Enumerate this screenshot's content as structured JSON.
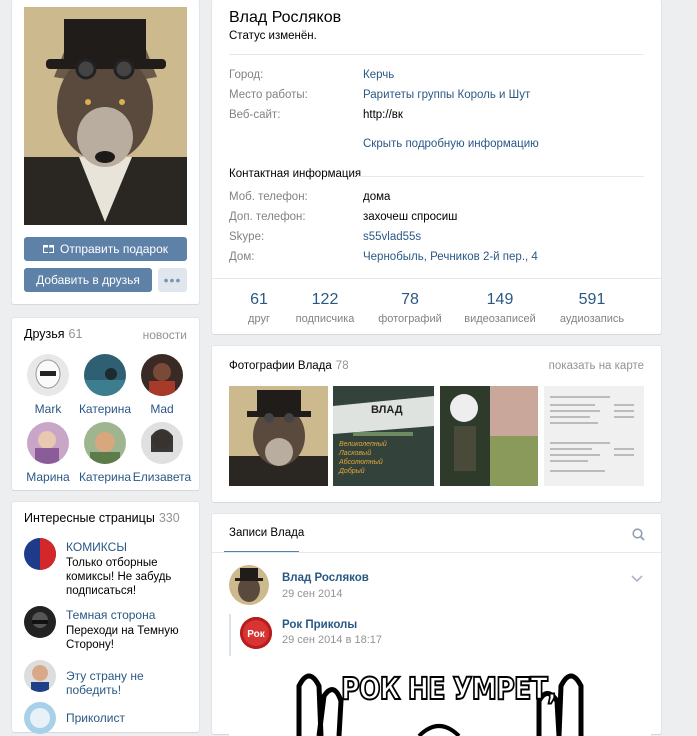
{
  "profile": {
    "name": "Влад Росляков",
    "status": "Статус изменён.",
    "info": [
      {
        "key": "Город:",
        "value": "Керчь",
        "link": true
      },
      {
        "key": "Место работы:",
        "value": "Раритеты группы Король и Шут",
        "link": true
      },
      {
        "key": "Веб-сайт:",
        "value": "http://вк",
        "link": false
      }
    ],
    "more_info": "Скрыть подробную информацию",
    "contact_heading": "Контактная информация",
    "contacts": [
      {
        "key": "Моб. телефон:",
        "value": "дома",
        "link": false
      },
      {
        "key": "Доп. телефон:",
        "value": "захочеш спросиш",
        "link": false
      },
      {
        "key": "Skype:",
        "value": "s55vlad55s",
        "link": true
      },
      {
        "key": "Дом:",
        "value": "Чернобыль, Речников 2-й пер., 4",
        "link": true
      }
    ],
    "counters": [
      {
        "n": "61",
        "label": "друг"
      },
      {
        "n": "122",
        "label": "подписчика"
      },
      {
        "n": "78",
        "label": "фотографий"
      },
      {
        "n": "149",
        "label": "видеозаписей"
      },
      {
        "n": "591",
        "label": "аудиозапись"
      }
    ]
  },
  "buttons": {
    "gift": "Отправить подарок",
    "add_friend": "Добавить в друзья",
    "more": "•••"
  },
  "friends": {
    "title": "Друзья",
    "count": "61",
    "more": "новости",
    "items": [
      {
        "name": "Mark"
      },
      {
        "name": "Катерина"
      },
      {
        "name": "Mad"
      },
      {
        "name": "Марина"
      },
      {
        "name": "Катерина"
      },
      {
        "name": "Елизавета"
      }
    ]
  },
  "pages": {
    "title": "Интересные страницы",
    "count": "330",
    "items": [
      {
        "title": "КОМИКСЫ",
        "desc": "Только отборные комиксы! Не забудь подписаться!"
      },
      {
        "title": "Темная сторона",
        "desc": "Переходи на Темную Сторону!"
      },
      {
        "title": "Эту страну не победить!",
        "desc": ""
      },
      {
        "title": "Приколист",
        "desc": ""
      }
    ]
  },
  "photos": {
    "title": "Фотографии Влада",
    "count": "78",
    "map_link": "показать на карте",
    "thumb2_text": "ВЛАД",
    "thumb2_lines": [
      "Великолепный",
      "Ласковый",
      "Абсолютный",
      "Добрый"
    ]
  },
  "wall": {
    "tab": "Записи Влада",
    "post": {
      "author": "Влад Росляков",
      "date": "29 сен 2014"
    },
    "repost": {
      "author": "Рок Приколы",
      "date": "29 сен 2014 в 18:17",
      "avatar_text": "Рок",
      "image_text": "РОК НЕ УМРЕТ,"
    }
  }
}
